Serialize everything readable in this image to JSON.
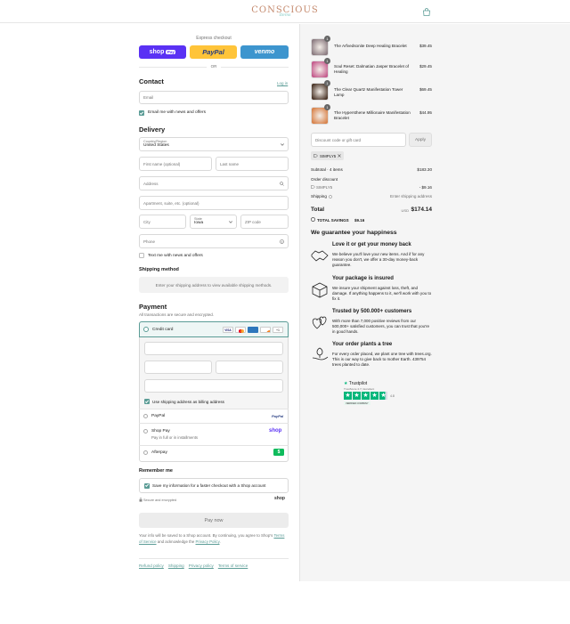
{
  "header": {
    "brand": "CONSCIOUS",
    "brand_sub": "Items"
  },
  "express": {
    "label": "Express checkout",
    "shop_pay": "shop",
    "shop_pay_badge": "Pay",
    "paypal": "PayPal",
    "venmo": "venmo",
    "or": "OR"
  },
  "contact": {
    "title": "Contact",
    "login": "Log in",
    "email_placeholder": "Email",
    "newsletter": "Email me with news and offers"
  },
  "delivery": {
    "title": "Delivery",
    "country_label": "Country/Region",
    "country_value": "United States",
    "first_name": "First name (optional)",
    "last_name": "Last name",
    "address": "Address",
    "apartment": "Apartment, suite, etc. (optional)",
    "city": "City",
    "state_label": "State",
    "state_value": "Iowa",
    "zip": "ZIP code",
    "phone": "Phone",
    "sms": "Text me with news and offers"
  },
  "shipping": {
    "title": "Shipping method",
    "note": "Enter your shipping address to view available shipping methods."
  },
  "payment": {
    "title": "Payment",
    "subtitle": "All transactions are secure and encrypted.",
    "credit_card": "Credit card",
    "more_cards": "+1",
    "billing_same": "Use shipping address as billing address",
    "paypal": "PayPal",
    "shoppay": "Shop Pay",
    "shoppay_sub": "Pay in full or in installments",
    "shoppay_logo": "shop",
    "afterpay": "Afterpay",
    "afterpay_logo": "$"
  },
  "remember": {
    "title": "Remember me",
    "save_info": "Save my information for a faster checkout with a Shop account",
    "secure": "Secure and encrypted",
    "shop_logo": "shop"
  },
  "pay_now": "Pay now",
  "legal": {
    "text1": "Your info will be saved to a Shop account. By continuing, you agree to Shop's",
    "terms": "Terms of Service",
    "and": "and acknowledge the",
    "privacy": "Privacy Policy",
    "dot": "."
  },
  "footer_links": [
    "Refund policy",
    "Shipping",
    "Privacy policy",
    "Terms of service"
  ],
  "cart": {
    "items": [
      {
        "name": "The Arfvedsonite Deep Healing Bracelet",
        "price": "$39.45",
        "qty": "1",
        "color": "#8a7a80"
      },
      {
        "name": "Soul Reset: Dalmatian Jasper Bracelet of Healing",
        "price": "$29.45",
        "qty": "1",
        "color": "#c45a8c"
      },
      {
        "name": "The Clear Quartz Manifestation Tower Lamp",
        "price": "$69.45",
        "qty": "1",
        "color": "#4a3528"
      },
      {
        "name": "The Hypersthene Millionaire Manifestation Bracelet",
        "price": "$44.95",
        "qty": "1",
        "color": "#d8824a"
      }
    ],
    "discount_placeholder": "Discount code or gift card",
    "apply": "Apply",
    "code": "SIMPLY5",
    "subtotal_label": "Subtotal · 4 items",
    "subtotal": "$183.30",
    "order_discount": "Order discount",
    "discount_code": "SIMPLY5",
    "discount_amount": "- $9.16",
    "shipping_label": "Shipping",
    "shipping_value": "Enter shipping address",
    "total_label": "Total",
    "currency": "USD",
    "total": "$174.14",
    "savings_label": "TOTAL SAVINGS",
    "savings": "$9.16"
  },
  "guarantee": {
    "title": "We guarantee your happiness",
    "items": [
      {
        "title": "Love it or get your money back",
        "body": "We believe you'll love your new items. And if for any reason you don't, we offer a 30-day money-back guarantee.",
        "icon": "handshake-icon"
      },
      {
        "title": "Your package is insured",
        "body": "We insure your shipment against loss, theft, and damage. If anything happens to it, we'll work with you to fix it.",
        "icon": "package-icon"
      },
      {
        "title": "Trusted by 500.000+ customers",
        "body": "With more than 7,000 positive reviews from our 500,000+ satisfied customers, you can trust that you're in good hands.",
        "icon": "hearts-icon"
      },
      {
        "title": "Your order plants a tree",
        "body": "For every order placed, we plant one tree with trees.org. This is our way to give back to mother Earth. 439754 trees planted to date.",
        "icon": "tree-hand-icon"
      }
    ]
  },
  "trustpilot": {
    "brand": "Trustpilot",
    "score_text": "TrustScore 4.7 | Excellent",
    "rating": "4.8",
    "verified": "VERIFIED COMPANY"
  },
  "colors": {
    "accent": "#5b9c96",
    "shop": "#5a31f4",
    "paypal": "#ffc439",
    "venmo": "#3d95ce",
    "trustpilot": "#00b67a"
  }
}
